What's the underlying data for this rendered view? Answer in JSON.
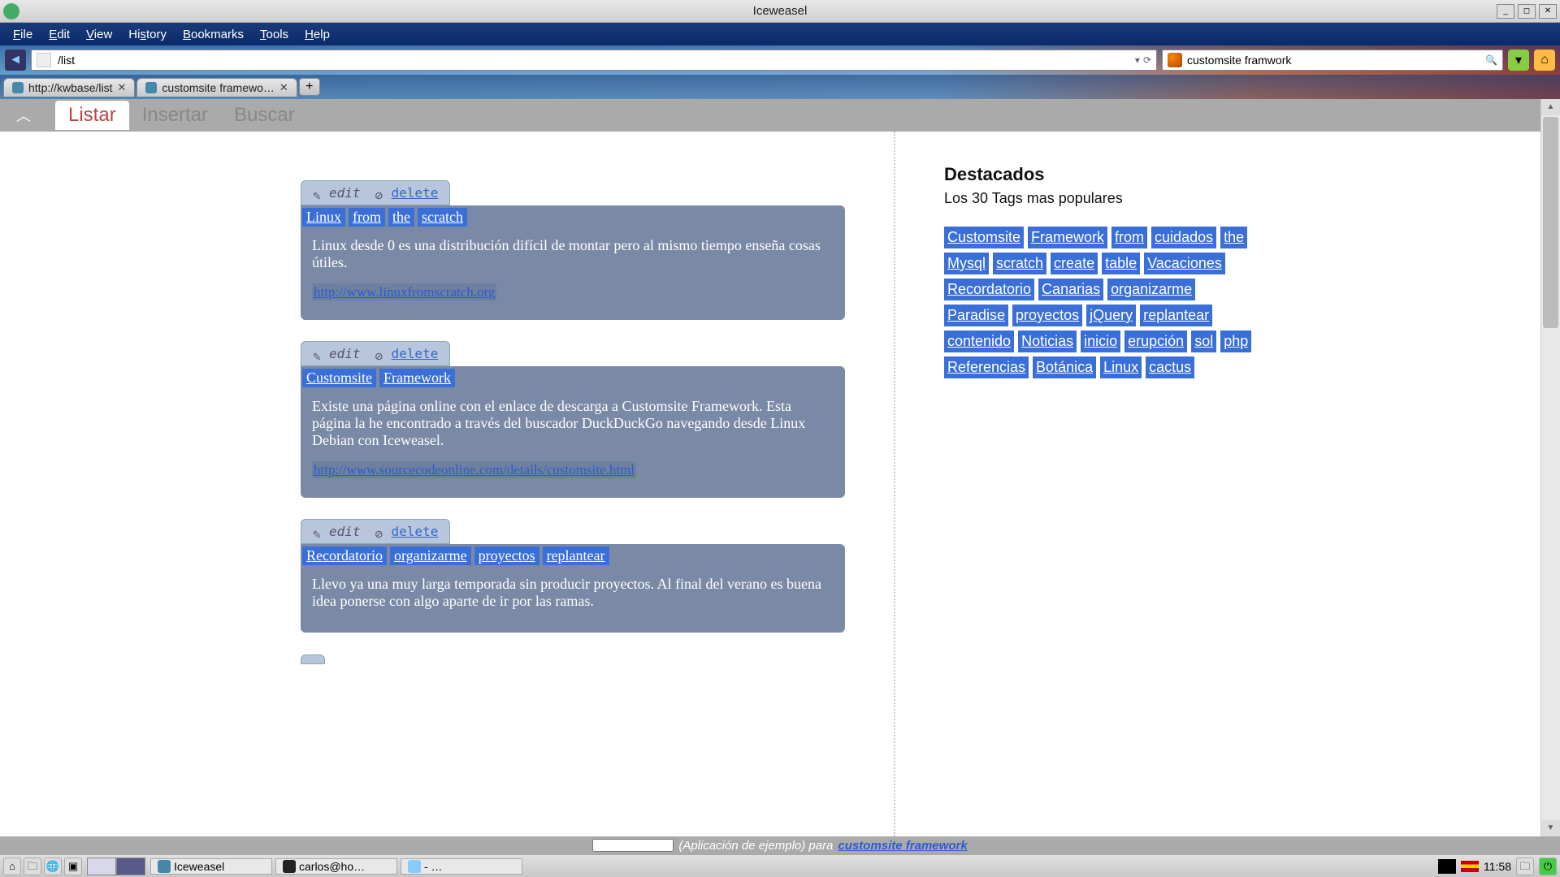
{
  "window": {
    "title": "Iceweasel"
  },
  "menu": {
    "file": "File",
    "edit": "Edit",
    "view": "View",
    "history": "History",
    "bookmarks": "Bookmarks",
    "tools": "Tools",
    "help": "Help"
  },
  "addressbar": {
    "url": "/list"
  },
  "searchbox": {
    "query": "customsite framwork"
  },
  "tabs": [
    {
      "label": "http://kwbase/list"
    },
    {
      "label": "customsite framewo…"
    }
  ],
  "appnav": {
    "listar": "Listar",
    "insertar": "Insertar",
    "buscar": "Buscar"
  },
  "cards": [
    {
      "edit": "edit",
      "delete": "delete",
      "tags": [
        "Linux",
        "from",
        "the",
        "scratch"
      ],
      "text": "Linux desde 0 es una distribución difícil de montar pero al mismo tiempo enseña cosas útiles.",
      "link": "http://www.linuxfromscratch.org"
    },
    {
      "edit": "edit",
      "delete": "delete",
      "tags": [
        "Customsite",
        "Framework"
      ],
      "text": "Existe una página online con el enlace de descarga a Customsite Framework. Esta página la he encontrado a través del buscador DuckDuckGo navegando desde Linux Debian con Iceweasel.",
      "link": "http://www.sourcecodeonline.com/details/customsite.html"
    },
    {
      "edit": "edit",
      "delete": "delete",
      "tags": [
        "Recordatorio",
        "organizarme",
        "proyectos",
        "replantear"
      ],
      "text": "Llevo ya una muy larga temporada sin producir proyectos. Al final del verano es buena idea ponerse con algo aparte de ir por las ramas.",
      "link": ""
    }
  ],
  "sidebar": {
    "heading": "Destacados",
    "sub": "Los 30 Tags mas populares",
    "tags": [
      "Customsite",
      "Framework",
      "from",
      "cuidados",
      "the",
      "Mysql",
      "scratch",
      "create",
      "table",
      "Vacaciones",
      "Recordatorio",
      "Canarias",
      "organizarme",
      "Paradise",
      "proyectos",
      "jQuery",
      "replantear",
      "contenido",
      "Noticias",
      "inicio",
      "erupción",
      "sol",
      "php",
      "Referencias",
      "Botánica",
      "Linux",
      "cactus"
    ]
  },
  "footer": {
    "text": "(Aplicación de ejemplo) para",
    "link": "customsite framework"
  },
  "taskbar": {
    "tasks": [
      {
        "label": "Iceweasel",
        "cls": "web"
      },
      {
        "label": "carlos@ho…",
        "cls": "term"
      },
      {
        "label": " - …",
        "cls": "cube"
      }
    ],
    "clock": "11:58"
  }
}
